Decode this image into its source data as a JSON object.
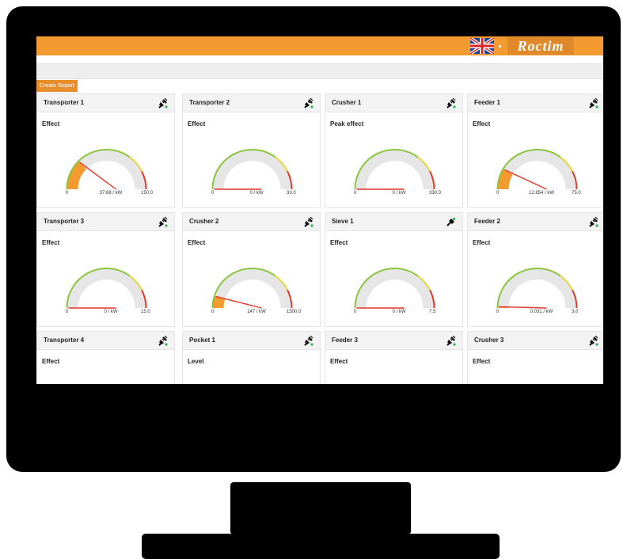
{
  "header": {
    "brand": "Roctim",
    "flag_icon": "uk-flag-icon",
    "accent_color": "#f39a31"
  },
  "toolbar": {
    "create_report_label": "Create Report"
  },
  "cards": [
    {
      "title": "Transporter 1",
      "metric": "Effect",
      "min": "0",
      "value_label": "37.68 / kW",
      "max": "150.0",
      "value": 37.68,
      "max_value": 150.0,
      "icon": "unplugged-icon"
    },
    {
      "title": "Transporter 2",
      "metric": "Effect",
      "min": "0",
      "value_label": "0 / kW",
      "max": "33.0",
      "value": 0,
      "max_value": 33.0,
      "icon": "unplugged-icon"
    },
    {
      "title": "Crusher 1",
      "metric": "Peak effect",
      "min": "0",
      "value_label": "0 / kW",
      "max": "330.0",
      "value": 0,
      "max_value": 330.0,
      "icon": "unplugged-icon"
    },
    {
      "title": "Feeder 1",
      "metric": "Effect",
      "min": "0",
      "value_label": "12.854 / kW",
      "max": "75.0",
      "value": 12.854,
      "max_value": 75.0,
      "icon": "unplugged-icon"
    },
    {
      "title": "Transporter 3",
      "metric": "Effect",
      "min": "0",
      "value_label": "0 / kW",
      "max": "15.0",
      "value": 0,
      "max_value": 15.0,
      "icon": "unplugged-icon"
    },
    {
      "title": "Crusher 2",
      "metric": "Effect",
      "min": "0",
      "value_label": "147 / kW",
      "max": "1500.0",
      "value": 147,
      "max_value": 1500.0,
      "icon": "unplugged-icon"
    },
    {
      "title": "Sieve 1",
      "metric": "Effect",
      "min": "0",
      "value_label": "0 / kW",
      "max": "7.5",
      "value": 0,
      "max_value": 7.5,
      "icon": "plugged-icon"
    },
    {
      "title": "Feeder 2",
      "metric": "Effect",
      "min": "0",
      "value_label": "0.031 / kW",
      "max": "3.0",
      "value": 0.031,
      "max_value": 3.0,
      "icon": "unplugged-icon"
    },
    {
      "title": "Transporter 4",
      "metric": "Effect",
      "icon": "unplugged-icon"
    },
    {
      "title": "Pocket 1",
      "metric": "Level",
      "icon": "unplugged-icon"
    },
    {
      "title": "Feeder 3",
      "metric": "Effect",
      "icon": "unplugged-icon"
    },
    {
      "title": "Crusher 3",
      "metric": "Effect",
      "icon": "unplugged-icon"
    }
  ],
  "colors": {
    "gauge_track": "#e6e6e6",
    "gauge_fill": "#f39a31",
    "zone_green": "#8cc540",
    "zone_yellow": "#e8d53a",
    "zone_red": "#e23b2e",
    "needle": "#e0342b"
  }
}
